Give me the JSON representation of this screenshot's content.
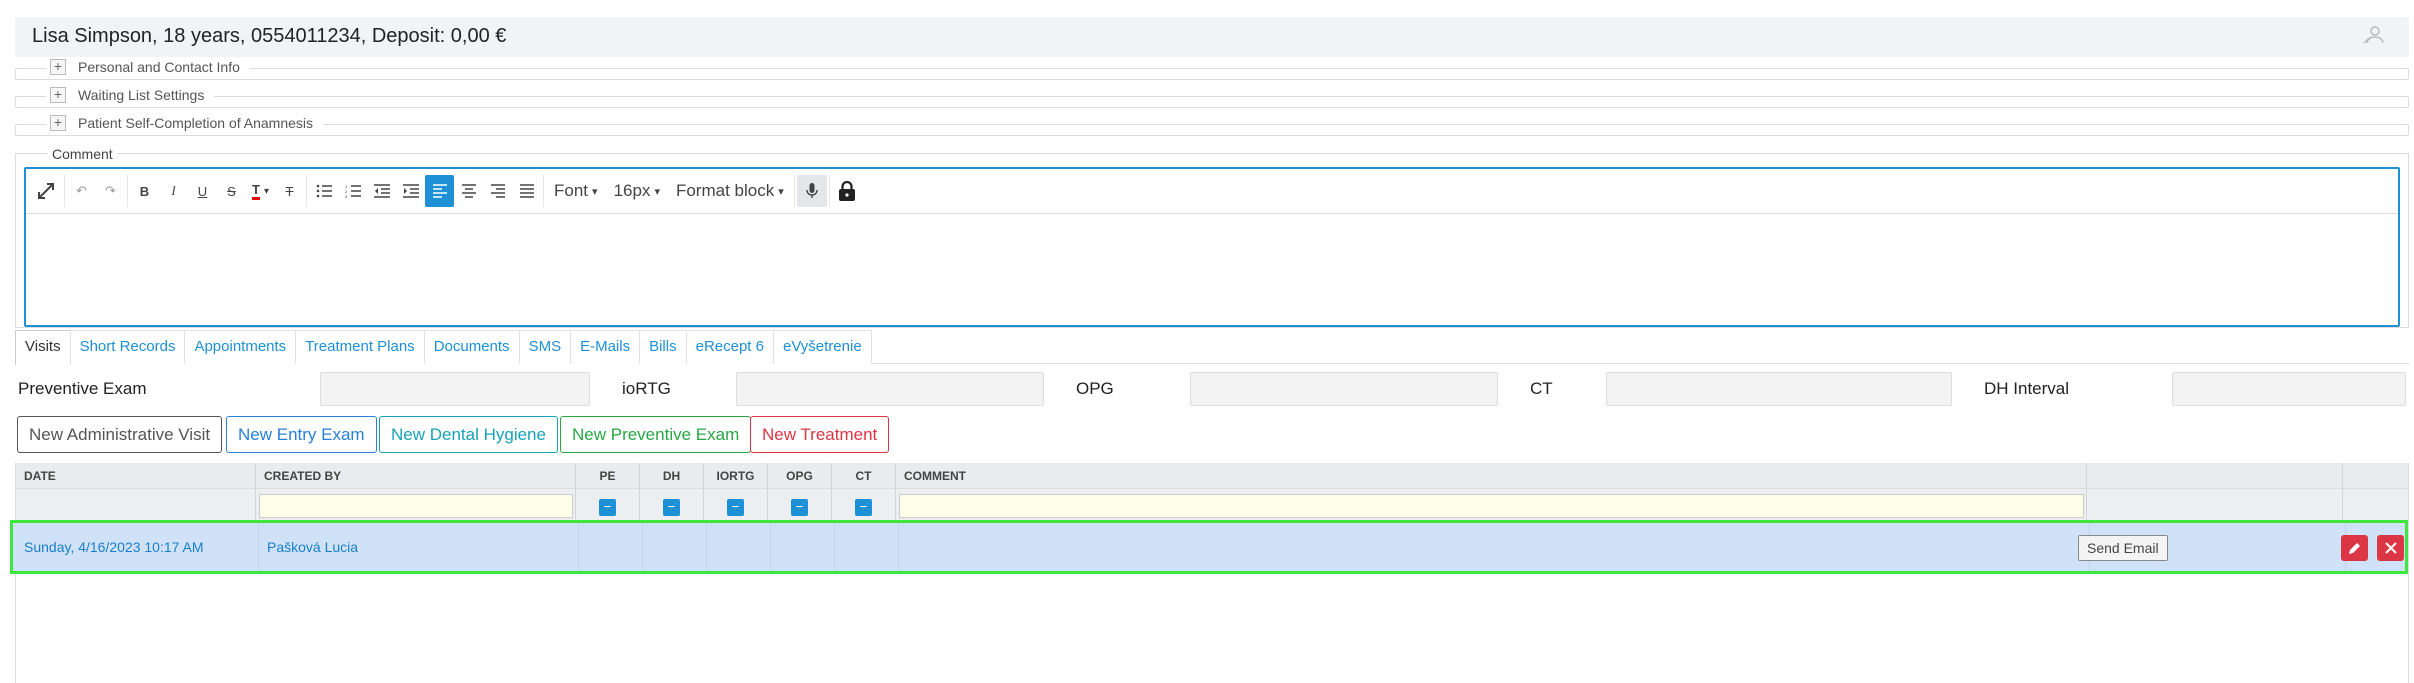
{
  "header": {
    "patient_line": "Lisa Simpson, 18 years, 0554011234, Deposit: 0,00 €"
  },
  "sections": [
    {
      "label": "Personal and Contact Info"
    },
    {
      "label": "Waiting List Settings"
    },
    {
      "label": "Patient Self-Completion of Anamnesis"
    }
  ],
  "comment": {
    "label": "Comment",
    "toolbar": {
      "font_label": "Font",
      "size_label": "16px",
      "block_label": "Format block"
    }
  },
  "tabs": [
    {
      "label": "Visits",
      "active": true
    },
    {
      "label": "Short Records"
    },
    {
      "label": "Appointments"
    },
    {
      "label": "Treatment Plans"
    },
    {
      "label": "Documents"
    },
    {
      "label": "SMS"
    },
    {
      "label": "E-Mails"
    },
    {
      "label": "Bills"
    },
    {
      "label": "eRecept 6"
    },
    {
      "label": "eVyšetrenie"
    }
  ],
  "fields": {
    "preventive_exam": "Preventive Exam",
    "iortg": "ioRTG",
    "opg": "OPG",
    "ct": "CT",
    "dh_interval": "DH Interval"
  },
  "buttons": {
    "new_admin_visit": "New Administrative Visit",
    "new_entry_exam": "New Entry Exam",
    "new_dental_hygiene": "New Dental Hygiene",
    "new_preventive_exam": "New Preventive Exam",
    "new_treatment": "New Treatment"
  },
  "grid": {
    "columns": {
      "date": "DATE",
      "created_by": "CREATED BY",
      "pe": "PE",
      "dh": "DH",
      "iortg": "IORTG",
      "opg": "OPG",
      "ct": "CT",
      "comment": "COMMENT"
    },
    "filter_check_symbol": "−",
    "rows": [
      {
        "date": "Sunday, 4/16/2023 10:17 AM",
        "created_by": "Pašková Lucia",
        "action_label": "Send Email"
      }
    ]
  },
  "colors": {
    "accent": "#1e90d6",
    "selected_row": "#cfe2f7",
    "highlight_border": "#3ee63e",
    "danger": "#dc3545"
  }
}
